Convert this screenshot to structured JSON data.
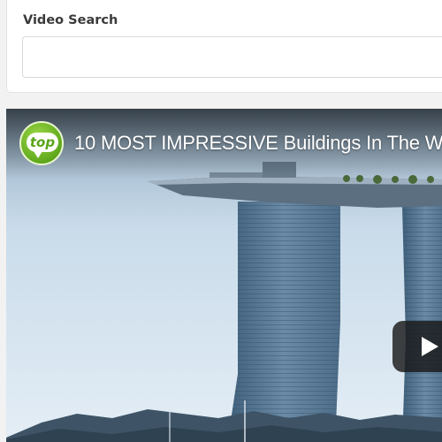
{
  "search_card": {
    "title": "Video Search",
    "input_value": "",
    "input_placeholder": ""
  },
  "video_player": {
    "channel_logo_text": "top",
    "title": "10 MOST IMPRESSIVE Buildings In The W",
    "play_icon": "play-icon",
    "channel_logo_color": "#5fa81b"
  }
}
